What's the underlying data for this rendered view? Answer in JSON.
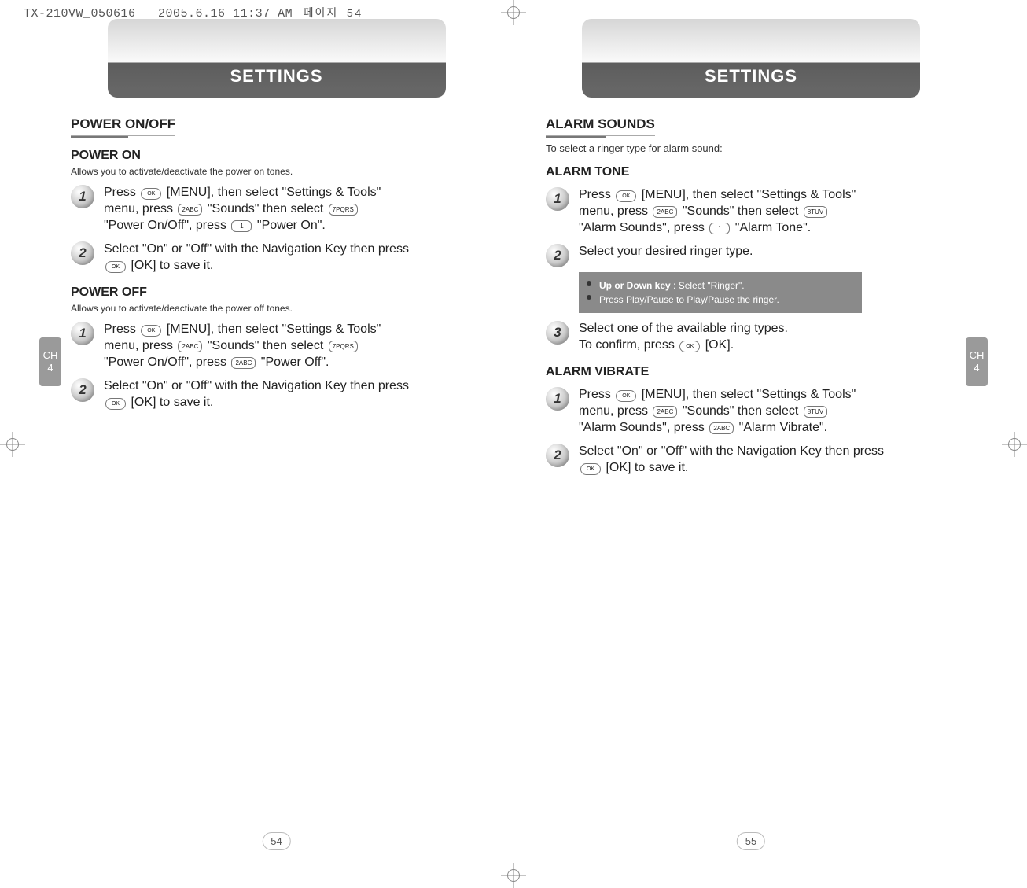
{
  "meta": {
    "doc_id": "TX-210VW_050616",
    "timestamp": "2005.6.16  11:37 AM",
    "hangul": "페이지 54"
  },
  "chapter_tab": {
    "label_ch": "CH",
    "label_num": "4"
  },
  "left": {
    "header": "SETTINGS",
    "s1_title": "POWER ON/OFF",
    "poweron_title": "POWER ON",
    "poweron_desc": "Allows you to activate/deactivate the power on tones.",
    "poweron_step1_a": "Press ",
    "poweron_step1_b": " [MENU], then select \"Settings & Tools\" menu, press ",
    "poweron_step1_c": " \"Sounds\" then select ",
    "poweron_step1_d": " \"Power On/Off\", press ",
    "poweron_step1_e": " \"Power On\".",
    "poweron_step2_a": "Select \"On\" or \"Off\" with the Navigation Key then press ",
    "poweron_step2_b": " [OK] to save it.",
    "poweroff_title": "POWER OFF",
    "poweroff_desc": "Allows you to activate/deactivate the power off tones.",
    "poweroff_step1_a": "Press ",
    "poweroff_step1_b": " [MENU], then select \"Settings & Tools\" menu, press ",
    "poweroff_step1_c": " \"Sounds\" then select ",
    "poweroff_step1_d": " \"Power On/Off\", press ",
    "poweroff_step1_e": " \"Power Off\".",
    "poweroff_step2_a": "Select \"On\" or \"Off\" with the Navigation Key then press ",
    "poweroff_step2_b": " [OK] to save it.",
    "pageno": "54"
  },
  "right": {
    "header": "SETTINGS",
    "s1_title": "ALARM SOUNDS",
    "intro": "To select a ringer type for alarm sound:",
    "tone_title": "ALARM TONE",
    "tone_step1_a": "Press ",
    "tone_step1_b": " [MENU], then select \"Settings & Tools\" menu, press ",
    "tone_step1_c": " \"Sounds\" then select ",
    "tone_step1_d": " \"Alarm Sounds\", press ",
    "tone_step1_e": " \"Alarm Tone\".",
    "tone_step2": "Select your desired ringer type.",
    "note_b1": "Up or Down key",
    "note_t1": " : Select \"Ringer\".",
    "note_t2": "Press Play/Pause to Play/Pause the ringer.",
    "tone_step3_a": "Select one of the available ring types.",
    "tone_step3_b": "To confirm, press ",
    "tone_step3_c": " [OK].",
    "vib_title": "ALARM VIBRATE",
    "vib_step1_a": "Press ",
    "vib_step1_b": " [MENU], then select \"Settings & Tools\" menu, press ",
    "vib_step1_c": " \"Sounds\" then select ",
    "vib_step1_d": " \"Alarm Sounds\", press ",
    "vib_step1_e": " \"Alarm Vibrate\".",
    "vib_step2_a": "Select \"On\" or \"Off\" with the Navigation Key then press ",
    "vib_step2_b": " [OK] to save it.",
    "pageno": "55"
  },
  "keycaps": {
    "ok": "OK",
    "k1": "1",
    "k2": "2ABC",
    "k7": "7PQRS",
    "k8": "8TUV"
  }
}
